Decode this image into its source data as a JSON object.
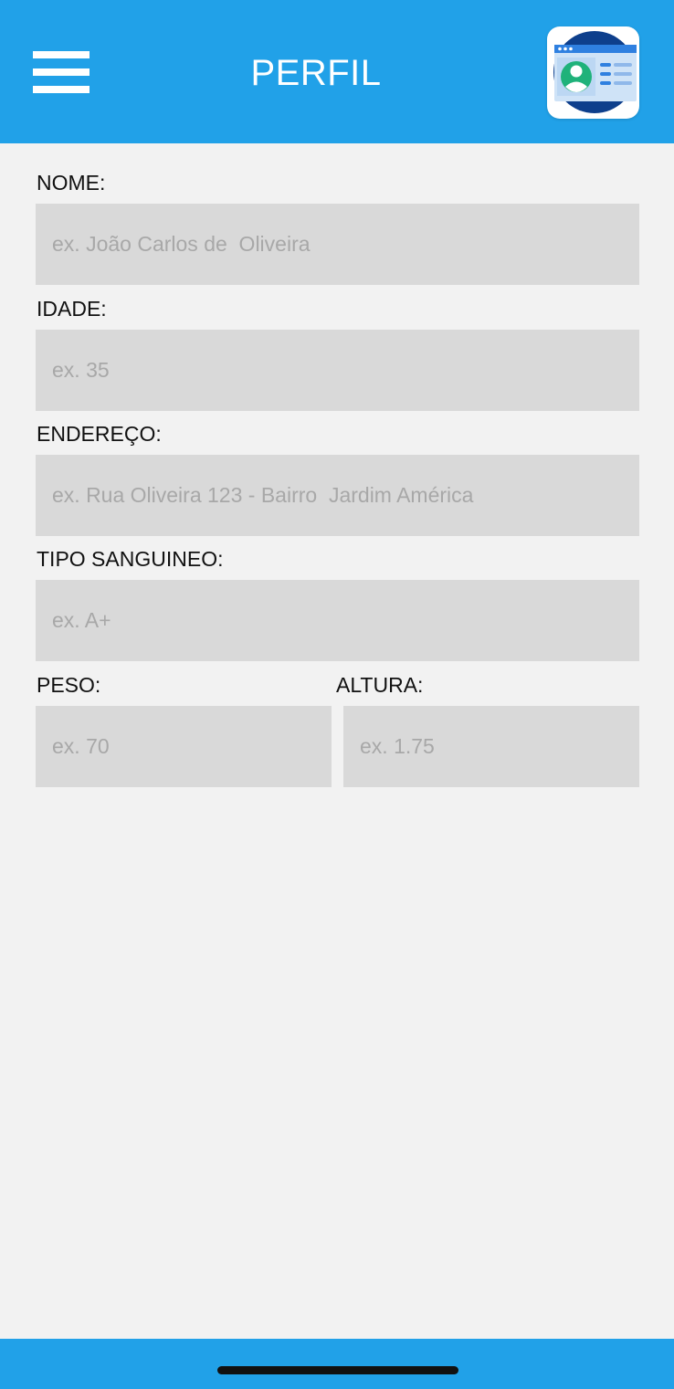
{
  "header": {
    "title": "PERFIL",
    "menu_icon": "hamburger-menu-icon",
    "profile_icon": "profile-card-icon",
    "background_color": "#21a1e8"
  },
  "form": {
    "nome": {
      "label": "NOME:",
      "placeholder": "ex. João Carlos de  Oliveira"
    },
    "idade": {
      "label": "IDADE:",
      "placeholder": "ex. 35"
    },
    "endereco": {
      "label": "ENDEREÇO:",
      "placeholder": "ex. Rua Oliveira 123 - Bairro  Jardim América"
    },
    "tipo_sanguineo": {
      "label": "TIPO SANGUINEO:",
      "placeholder": "ex. A+"
    },
    "peso": {
      "label": "PESO:",
      "placeholder": "ex. 70"
    },
    "altura": {
      "label": "ALTURA:",
      "placeholder": "ex. 1.75"
    }
  },
  "colors": {
    "accent": "#21a1e8",
    "input_background": "#d9d9d9",
    "page_background": "#f2f2f2"
  }
}
